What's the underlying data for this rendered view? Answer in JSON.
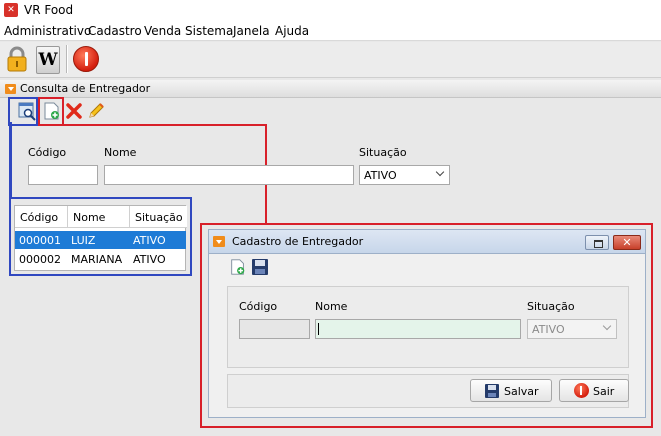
{
  "app": {
    "title": "VR Food",
    "icon": "restaurant-icon"
  },
  "menu": [
    "Administrativo",
    "Cadastro",
    "Venda",
    "Sistema",
    "Janela",
    "Ajuda"
  ],
  "toolbar": {
    "lock_icon": "lock-icon",
    "w_label": "W",
    "power_icon": "power-icon"
  },
  "consulta": {
    "title": "Consulta de Entregador",
    "tools": [
      "search-icon",
      "add-document-icon",
      "delete-icon",
      "edit-icon"
    ],
    "filters": {
      "codigo_label": "Código",
      "nome_label": "Nome",
      "situacao_label": "Situação",
      "situacao_value": "ATIVO"
    },
    "grid": {
      "headers": [
        "Código",
        "Nome",
        "Situação"
      ],
      "rows": [
        [
          "000001",
          "LUIZ",
          "ATIVO"
        ],
        [
          "000002",
          "MARIANA",
          "ATIVO"
        ]
      ]
    }
  },
  "cadastro": {
    "title": "Cadastro de Entregador",
    "tools": [
      "add-document-icon",
      "save-icon"
    ],
    "codigo_label": "Código",
    "nome_label": "Nome",
    "situacao_label": "Situação",
    "situacao_value": "ATIVO",
    "salvar_label": "Salvar",
    "sair_label": "Sair"
  },
  "colors": {
    "highlight_red": "#d8202a",
    "highlight_blue": "#3048c0",
    "selection": "#1e7bd6"
  }
}
